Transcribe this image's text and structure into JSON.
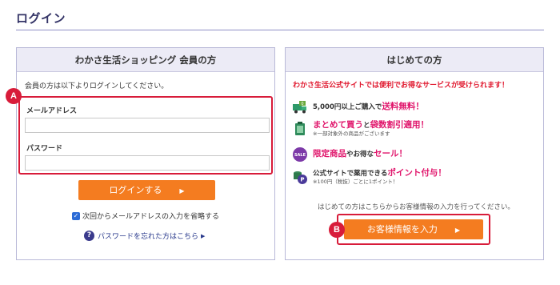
{
  "page": {
    "title": "ログイン"
  },
  "login": {
    "heading": "わかさ生活ショッピング 会員の方",
    "intro": "会員の方は以下よりログインしてください。",
    "email_label": "メールアドレス",
    "email_value": "",
    "password_label": "パスワード",
    "password_value": "",
    "badge_a": "A",
    "submit_label": "ログインする",
    "submit_arrow": "▶",
    "remember_label": "次回からメールアドレスの入力を省略する",
    "remember_checked": true,
    "forgot_icon_glyph": "?",
    "forgot_label": "パスワードを忘れた方はこちら",
    "forgot_arrow": "▶"
  },
  "newcomer": {
    "heading": "はじめての方",
    "headline": "わかさ生活公式サイトでは便利でお得なサービスが受けられます！",
    "benefits": [
      {
        "icon": "truck-icon",
        "icon_text": "0",
        "pre": "5,000円以上ご購入で",
        "em": "送料無料！",
        "post": "",
        "note": ""
      },
      {
        "icon": "bag-icon",
        "icon_text": "",
        "pre": "",
        "em": "まとめて買う",
        "post": "と",
        "em2": "袋数割引適用！",
        "note": "※一部対象外の商品がございます"
      },
      {
        "icon": "sale-tag-icon",
        "icon_text": "SALE",
        "pre": "",
        "em": "限定商品",
        "post": "やお得な",
        "em2": "セール！",
        "note": ""
      },
      {
        "icon": "points-coin-icon",
        "icon_text": "P",
        "pre": "公式サイトで薬用できる",
        "em": "ポイント付与！",
        "post": "",
        "note": "※100円（税抜）ごとに1ポイント！"
      }
    ],
    "first_note": "はじめての方はこちらからお客様情報の入力を行ってください。",
    "badge_b": "B",
    "register_label": "お客様情報を入力",
    "register_arrow": "▶"
  },
  "colors": {
    "accent_orange": "#f47c20",
    "highlight_red": "#d81c3a",
    "emphasis_pink": "#e0156b",
    "header_bg": "#ecebf6"
  }
}
